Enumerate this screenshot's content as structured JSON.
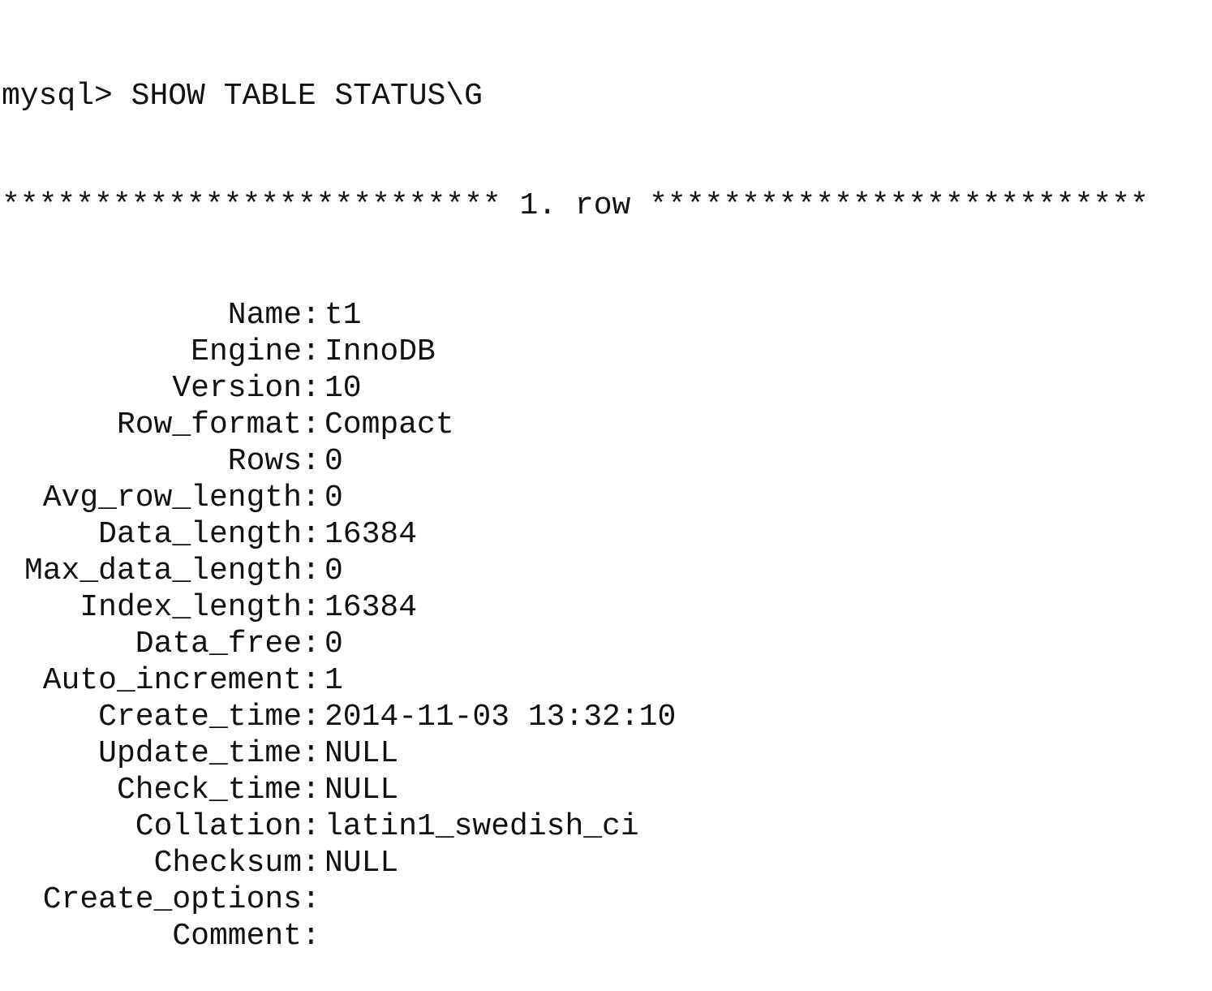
{
  "terminal": {
    "prompt": "mysql>",
    "command": "SHOW TABLE STATUS\\G",
    "row_separator": "*************************** 1. row ***************************",
    "fields": [
      {
        "key": "Name",
        "value": "t1"
      },
      {
        "key": "Engine",
        "value": "InnoDB"
      },
      {
        "key": "Version",
        "value": "10"
      },
      {
        "key": "Row_format",
        "value": "Compact"
      },
      {
        "key": "Rows",
        "value": "0"
      },
      {
        "key": "Avg_row_length",
        "value": "0"
      },
      {
        "key": "Data_length",
        "value": "16384"
      },
      {
        "key": "Max_data_length",
        "value": "0"
      },
      {
        "key": "Index_length",
        "value": "16384"
      },
      {
        "key": "Data_free",
        "value": "0"
      },
      {
        "key": "Auto_increment",
        "value": "1"
      },
      {
        "key": "Create_time",
        "value": "2014-11-03 13:32:10"
      },
      {
        "key": "Update_time",
        "value": "NULL"
      },
      {
        "key": "Check_time",
        "value": "NULL"
      },
      {
        "key": "Collation",
        "value": "latin1_swedish_ci"
      },
      {
        "key": "Checksum",
        "value": "NULL"
      },
      {
        "key": "Create_options",
        "value": ""
      },
      {
        "key": "Comment",
        "value": ""
      }
    ]
  }
}
